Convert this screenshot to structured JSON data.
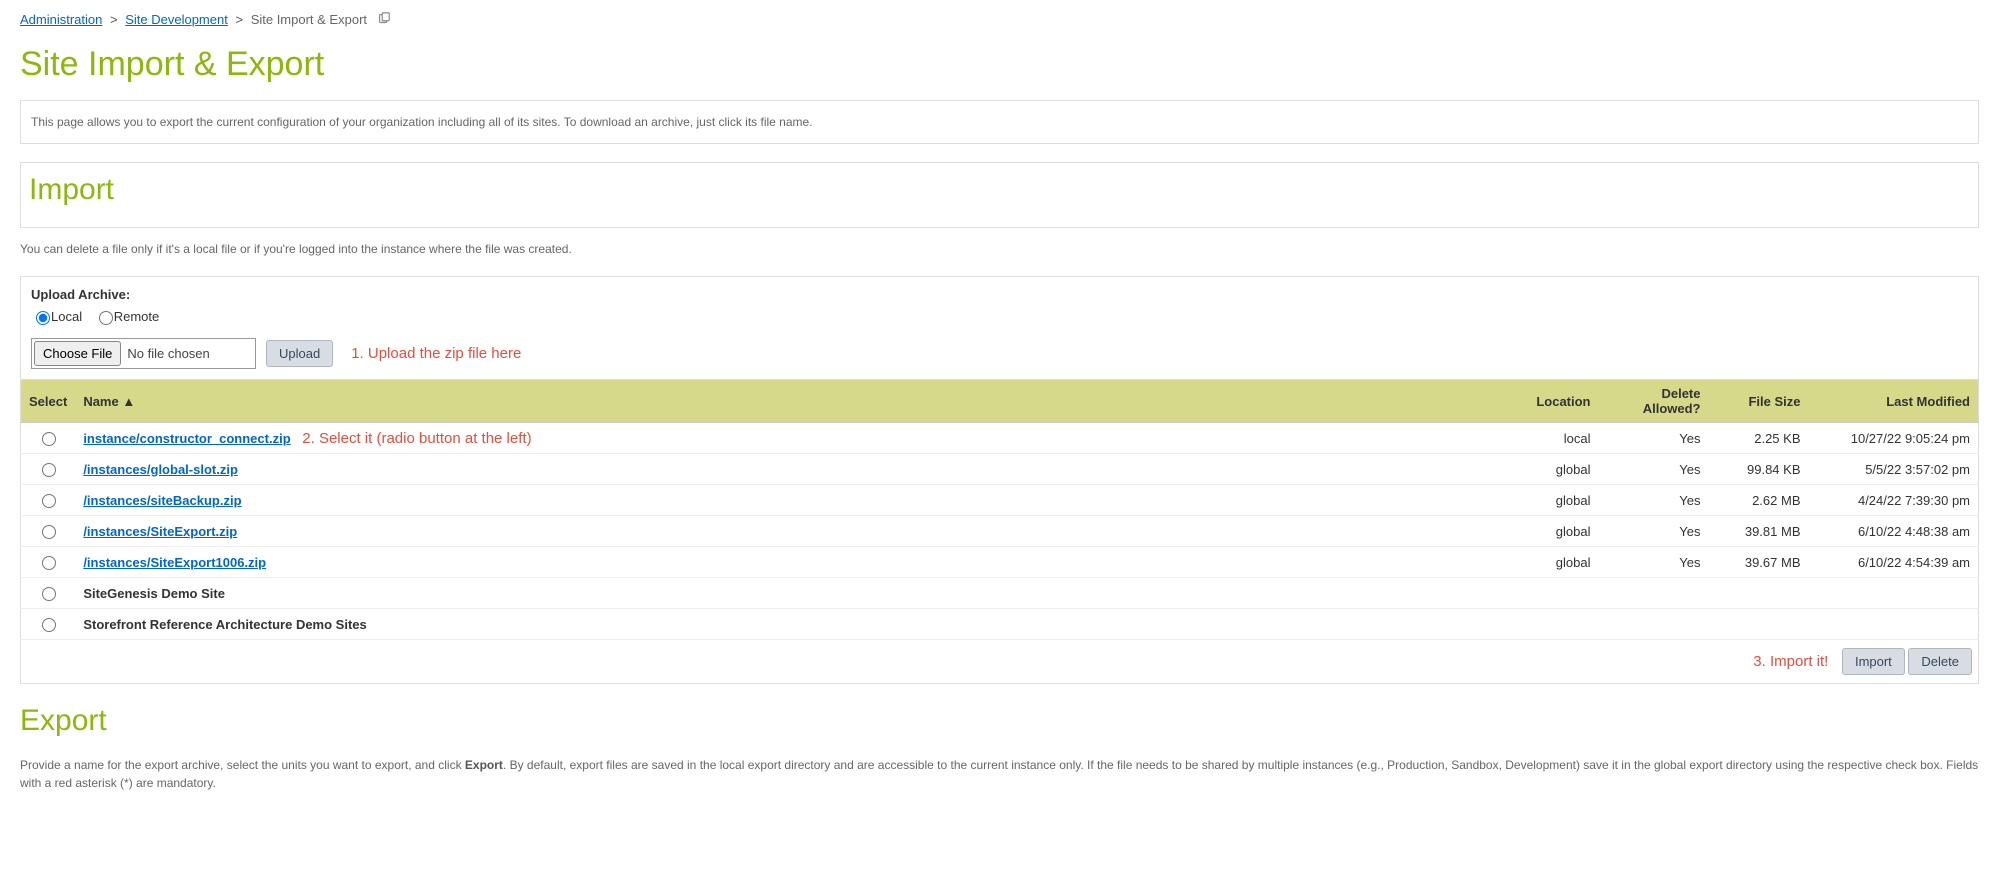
{
  "breadcrumb": {
    "item1": "Administration",
    "item2": "Site Development",
    "current": "Site Import & Export"
  },
  "page_title": "Site Import & Export",
  "description": "This page allows you to export the current configuration of your organization including all of its sites. To download an archive, just click its file name.",
  "import": {
    "title": "Import",
    "delete_note": "You can delete a file only if it's a local file or if you're logged into the instance where the file was created.",
    "upload_label": "Upload Archive:",
    "radio_local": "Local",
    "radio_remote": "Remote",
    "choose_file": "Choose File",
    "no_file": "No file chosen",
    "upload_btn": "Upload",
    "annotation_upload": "1. Upload the zip file here",
    "annotation_select": "2. Select it (radio button at the left)",
    "annotation_import": "3. Import it!",
    "import_btn": "Import",
    "delete_btn": "Delete"
  },
  "table": {
    "headers": {
      "select": "Select",
      "name": "Name ▲",
      "location": "Location",
      "delete_allowed": "Delete Allowed?",
      "file_size": "File Size",
      "last_modified": "Last Modified"
    },
    "rows": [
      {
        "name": "instance/constructor_connect.zip",
        "link": true,
        "location": "local",
        "delete_allowed": "Yes",
        "file_size": "2.25 KB",
        "last_modified": "10/27/22 9:05:24 pm",
        "annot": true
      },
      {
        "name": "/instances/global-slot.zip",
        "link": true,
        "location": "global",
        "delete_allowed": "Yes",
        "file_size": "99.84 KB",
        "last_modified": "5/5/22 3:57:02 pm"
      },
      {
        "name": "/instances/siteBackup.zip",
        "link": true,
        "location": "global",
        "delete_allowed": "Yes",
        "file_size": "2.62 MB",
        "last_modified": "4/24/22 7:39:30 pm"
      },
      {
        "name": "/instances/SiteExport.zip",
        "link": true,
        "location": "global",
        "delete_allowed": "Yes",
        "file_size": "39.81 MB",
        "last_modified": "6/10/22 4:48:38 am"
      },
      {
        "name": "/instances/SiteExport1006.zip",
        "link": true,
        "location": "global",
        "delete_allowed": "Yes",
        "file_size": "39.67 MB",
        "last_modified": "6/10/22 4:54:39 am"
      },
      {
        "name": "SiteGenesis Demo Site",
        "link": false,
        "location": "",
        "delete_allowed": "",
        "file_size": "",
        "last_modified": ""
      },
      {
        "name": "Storefront Reference Architecture Demo Sites",
        "link": false,
        "location": "",
        "delete_allowed": "",
        "file_size": "",
        "last_modified": ""
      }
    ]
  },
  "export": {
    "title": "Export",
    "note_before_bold": "Provide a name for the export archive, select the units you want to export, and click ",
    "note_bold": "Export",
    "note_after_bold": ". By default, export files are saved in the local export directory and are accessible to the current instance only. If the file needs to be shared by multiple instances (e.g., Production, Sandbox, Development) save it in the global export directory using the respective check box. Fields with a red asterisk (*) are mandatory."
  }
}
